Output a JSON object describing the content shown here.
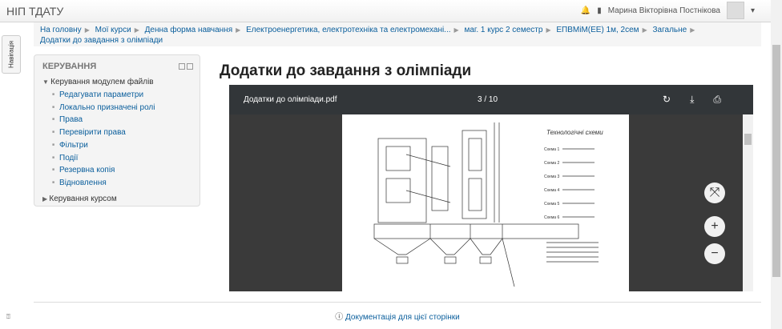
{
  "navbar": {
    "brand": "НІП ТДАТУ",
    "user": "Марина Вікторівна Постнікова"
  },
  "breadcrumb": [
    "На головну",
    "Мої курси",
    "Денна форма навчання",
    "Електроенергетика, електротехніка та електромехані...",
    "маг. 1 курс 2 семестр",
    "ЕПВМіМ(ЕЕ) 1м, 2сем",
    "Загальне",
    "Додатки до завдання з олімпіади"
  ],
  "nav_tab": "Навігація",
  "block": {
    "title": "КЕРУВАННЯ",
    "node1": "Керування модулем файлів",
    "items": [
      "Редагувати параметри",
      "Локально призначені ролі",
      "Права",
      "Перевірити права",
      "Фільтри",
      "Події",
      "Резервна копія",
      "Відновлення"
    ],
    "node2": "Керування курсом"
  },
  "page_title": "Додатки до завдання з олімпіади",
  "viewer": {
    "filename": "Додатки до олімпіади.pdf",
    "page": "3 / 10",
    "drawing_title": "Технологічні схеми"
  },
  "footer": {
    "doc_link": "Документація для цієї сторінки"
  }
}
